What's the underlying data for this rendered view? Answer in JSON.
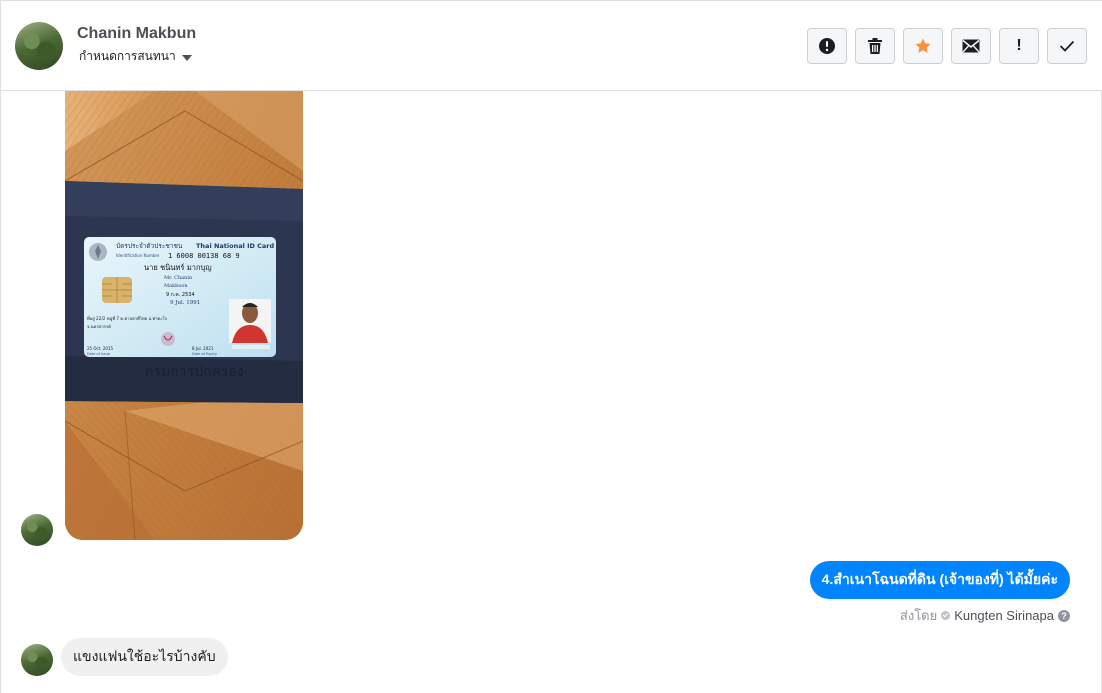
{
  "header": {
    "contact_name": "Chanin Makbun",
    "assign_label": "กำหนดการสนทนา",
    "tools": [
      {
        "icon": "alert-circle-icon"
      },
      {
        "icon": "trash-icon"
      },
      {
        "icon": "star-icon",
        "color": "#f7923b"
      },
      {
        "icon": "envelope-icon"
      },
      {
        "icon": "exclamation-icon",
        "label": "!"
      },
      {
        "icon": "check-icon"
      }
    ]
  },
  "photo": {
    "card_title_th": "บัตรประจำตัวประชาชน",
    "card_title_en": "Thai National ID Card",
    "id_caption": "Identification Number",
    "id_number": "1 6008 00138 68 9",
    "name_th": "นาย ชนินทร์ มากบุญ",
    "name_en": "Mr. Chanin",
    "last_name_en": "Makboon",
    "dob_th": "9 ก.ค. 2534",
    "dob_en": "9 Jul. 1991",
    "address": "ที่อยู่ 22/2 หมู่ที่ 7 ต.ตาลตาตีไทย อ.ท่าตะโก",
    "province": "จ.นครสวรรค์",
    "issue_date": "25 Oct. 2015",
    "expiry_date": "8 Jul. 2021",
    "issue_label": "Date of Issue",
    "expiry_label": "Date of Expiry"
  },
  "messages": {
    "outgoing_text": "4.สำเนาโฉนดที่ดิน (เจ้าของที่) ได้มั้ยค่ะ",
    "sent_by_label": "ส่งโดย",
    "sent_by_agent": "Kungten Sirinapa",
    "help": "?",
    "incoming_text": "แขงแฟนใช้อะไรบ้างคับ"
  },
  "colors": {
    "accent": "#0084ff",
    "incoming_bubble": "#f1f0f0",
    "star": "#f7923b"
  }
}
